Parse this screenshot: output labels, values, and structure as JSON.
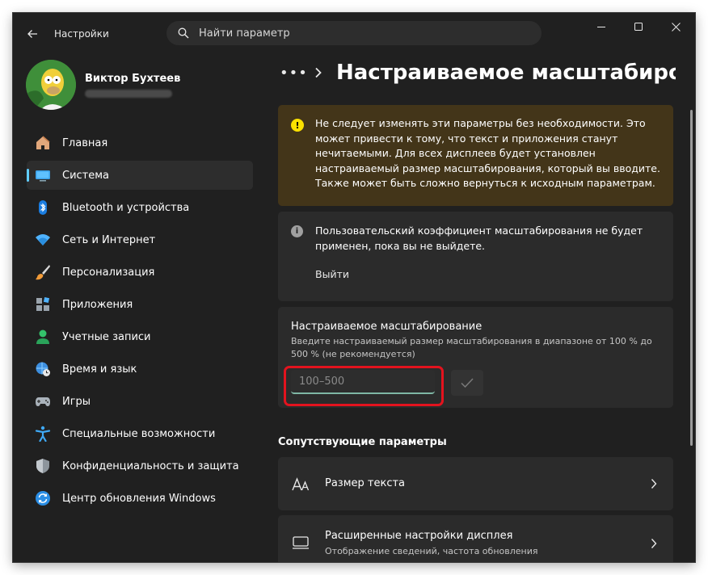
{
  "window": {
    "app_title": "Настройки",
    "search_placeholder": "Найти параметр"
  },
  "profile": {
    "name": "Виктор Бухтеев"
  },
  "sidebar": {
    "items": [
      {
        "label": "Главная",
        "icon": "home-icon"
      },
      {
        "label": "Система",
        "icon": "system-icon",
        "active": true
      },
      {
        "label": "Bluetooth и устройства",
        "icon": "bluetooth-icon"
      },
      {
        "label": "Сеть и Интернет",
        "icon": "wifi-icon"
      },
      {
        "label": "Персонализация",
        "icon": "brush-icon"
      },
      {
        "label": "Приложения",
        "icon": "apps-icon"
      },
      {
        "label": "Учетные записи",
        "icon": "person-icon"
      },
      {
        "label": "Время и язык",
        "icon": "globe-clock-icon"
      },
      {
        "label": "Игры",
        "icon": "gamepad-icon"
      },
      {
        "label": "Специальные возможности",
        "icon": "accessibility-icon"
      },
      {
        "label": "Конфиденциальность и защита",
        "icon": "shield-icon"
      },
      {
        "label": "Центр обновления Windows",
        "icon": "update-icon"
      }
    ]
  },
  "main": {
    "breadcrumb_more": "•••",
    "page_title": "Настраиваемое масштабирование",
    "warning": {
      "text": "Не следует изменять эти параметры без необходимости. Это может привести к тому, что текст и приложения станут нечитаемыми. Для всех дисплеев будет установлен настраиваемый размер масштабирования, который вы вводите. Также может быть сложно вернуться к исходным параметрам."
    },
    "info": {
      "text": "Пользовательский коэффициент масштабирования не будет применен, пока вы не выйдете.",
      "logout_label": "Выйти"
    },
    "custom_scaling": {
      "title": "Настраиваемое масштабирование",
      "description": "Введите настраиваемый размер масштабирования в диапазоне от 100 % до 500 % (не рекомендуется)",
      "input_placeholder": "100–500",
      "input_value": ""
    },
    "related": {
      "title": "Сопутствующие параметры",
      "items": [
        {
          "label": "Размер текста",
          "sub": "",
          "icon": "text-size-icon"
        },
        {
          "label": "Расширенные настройки дисплея",
          "sub": "Отображение сведений, частота обновления",
          "icon": "monitor-icon"
        }
      ]
    }
  },
  "colors": {
    "accent": "#60cdff",
    "warning_bg": "#433519",
    "warning_icon": "#fce100",
    "highlight_border": "#e3131e"
  }
}
